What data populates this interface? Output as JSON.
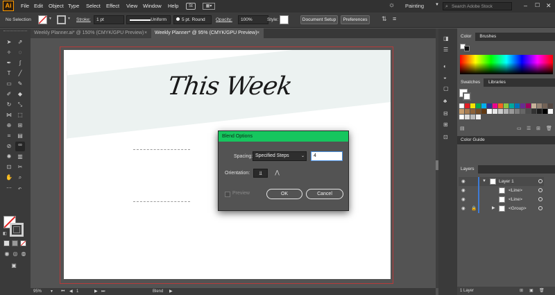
{
  "app": {
    "logo": "Ai",
    "workspace": "Painting",
    "search_placeholder": "Search Adobe Stock"
  },
  "menu": [
    "File",
    "Edit",
    "Object",
    "Type",
    "Select",
    "Effect",
    "View",
    "Window",
    "Help"
  ],
  "control_bar": {
    "selection_status": "No Selection",
    "stroke_label": "Stroke:",
    "stroke_value": "1 pt",
    "profile_value": "Uniform",
    "brush_value": "5 pt. Round",
    "opacity_label": "Opacity:",
    "opacity_value": "100%",
    "style_label": "Style:",
    "document_setup": "Document Setup",
    "preferences": "Preferences"
  },
  "tabs": [
    {
      "label": "Weekly Planner.ai* @ 150% (CMYK/GPU Preview)",
      "active": false
    },
    {
      "label": "Weekly Planner* @ 95% (CMYK/GPU Preview)",
      "active": true
    }
  ],
  "artboard": {
    "heading": "This Week"
  },
  "dialog": {
    "title": "Blend Options",
    "spacing_label": "Spacing:",
    "spacing_value": "Specified Steps",
    "steps_value": "4",
    "orientation_label": "Orientation:",
    "preview_label": "Preview",
    "ok": "OK",
    "cancel": "Cancel"
  },
  "status": {
    "zoom": "95%",
    "artboard_num": "1",
    "tool_name": "Blend"
  },
  "panels": {
    "color_tabs": [
      "Color",
      "Brushes"
    ],
    "swatch_tabs": [
      "Swatches",
      "Libraries"
    ],
    "color_guide": "Color Guide",
    "layers_tab": "Layers",
    "layers": [
      {
        "name": "Layer 1",
        "indent": 0
      },
      {
        "name": "<Line>",
        "indent": 1
      },
      {
        "name": "<Line>",
        "indent": 1
      },
      {
        "name": "<Group>",
        "indent": 1
      }
    ],
    "layers_count": "1 Layer"
  },
  "colors": {
    "accent_green": "#16c65e",
    "artboard_red": "#b73a3a",
    "layer_blue": "#3d7bd6"
  }
}
